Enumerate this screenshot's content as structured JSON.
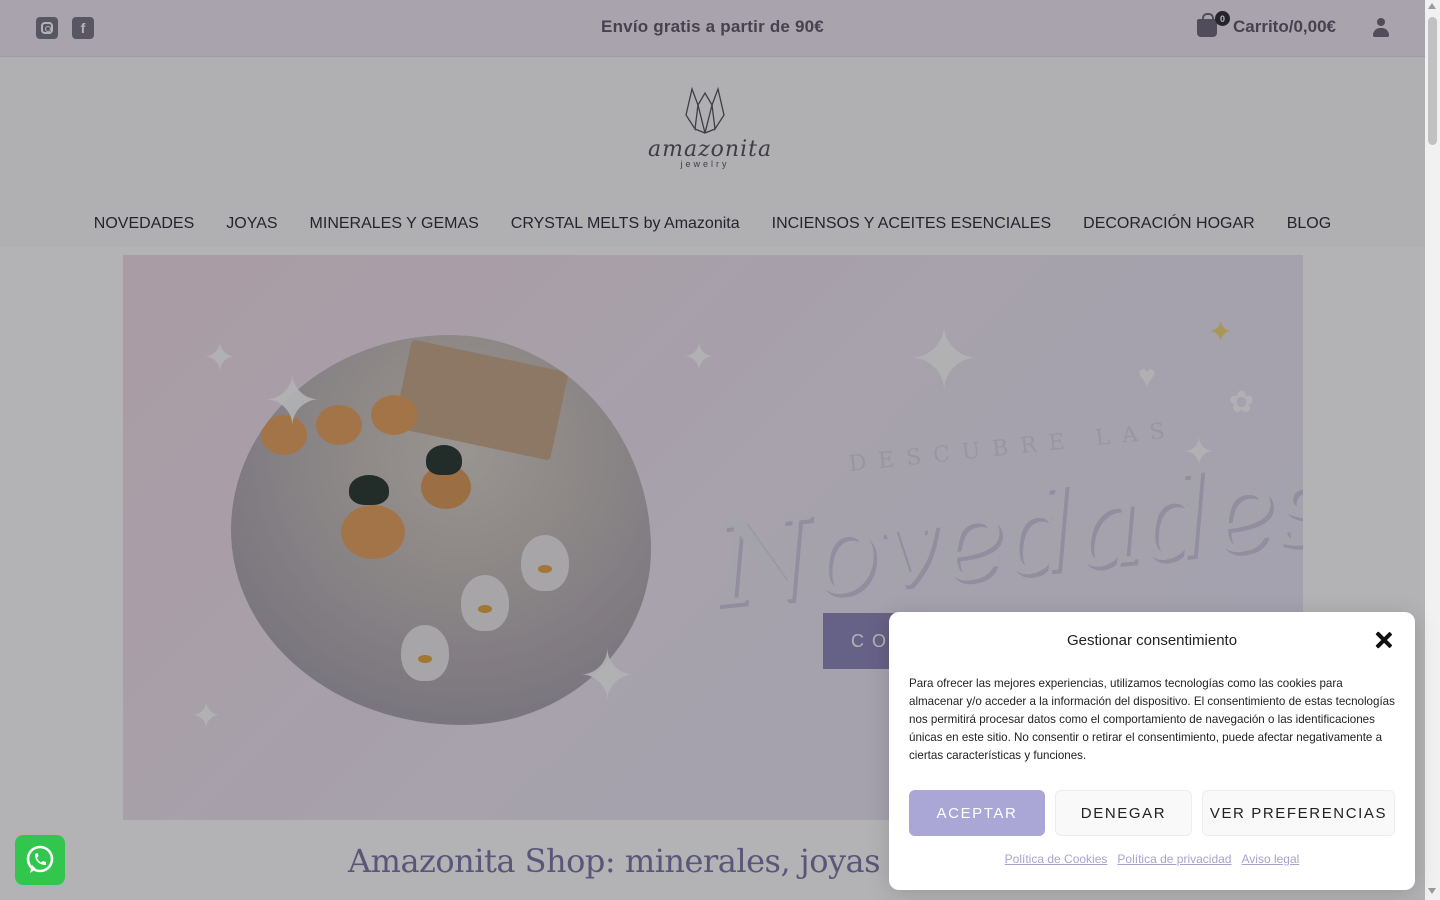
{
  "topbar": {
    "promo": "Envío gratis a partir de 90€",
    "cart_label": "Carrito/0,00€",
    "cart_count": "0",
    "icons": [
      "instagram-icon",
      "facebook-icon",
      "shopping-bag-icon",
      "user-icon"
    ]
  },
  "logo": {
    "name": "amazonita",
    "tagline": "jewelry"
  },
  "nav": {
    "items": [
      "NOVEDADES",
      "JOYAS ",
      "MINERALES Y GEMAS ",
      "CRYSTAL MELTS by Amazonita ",
      "INCIENSOS Y ACEITES ESENCIALES ",
      "DECORACIÓN HOGAR ",
      "BLOG "
    ]
  },
  "hero": {
    "kicker": "DESCUBRE LAS",
    "title": "Novedades",
    "cta": "COMPRAR"
  },
  "headline": "Amazonita Shop: minerales, joyas con piedras naturales",
  "consent": {
    "title": "Gestionar consentimiento",
    "body": "Para ofrecer las mejores experiencias, utilizamos tecnologías como las cookies para almacenar y/o acceder a la información del dispositivo. El consentimiento de estas tecnologías nos permitirá procesar datos como el comportamiento de navegación o las identificaciones únicas en este sitio. No consentir o retirar el consentimiento, puede afectar negativamente a ciertas características y funciones.",
    "accept": "ACEPTAR",
    "deny": "DENEGAR",
    "preferences": "VER PREFERENCIAS",
    "links": [
      "Política de Cookies",
      "Política de privacidad",
      "Aviso legal"
    ]
  },
  "colors": {
    "topbar_bg": "#f1e8f3",
    "accent": "#aaa6d6",
    "link": "#a7a3cf",
    "whatsapp": "#33c64f"
  }
}
